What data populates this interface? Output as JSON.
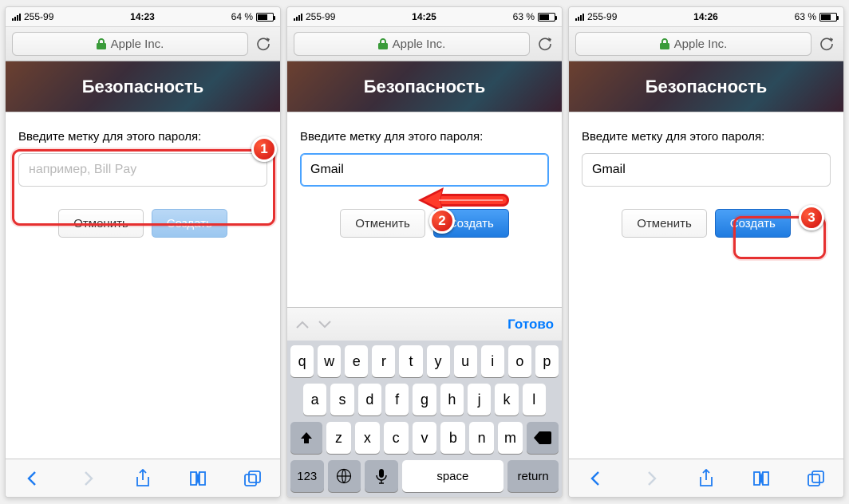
{
  "screens": [
    {
      "status": {
        "carrier": "255-99",
        "time": "14:23",
        "battery_percent": "64 %",
        "battery_fill": 0.64,
        "step": "1"
      },
      "address": "Apple Inc.",
      "banner_title": "Безопасность",
      "form": {
        "label": "Введите метку для этого пароля:",
        "value": "",
        "placeholder": "например, Bill Pay",
        "cancel": "Отменить",
        "create": "Создать",
        "create_disabled": true,
        "focused": false
      }
    },
    {
      "status": {
        "carrier": "255-99",
        "time": "14:25",
        "battery_percent": "63 %",
        "battery_fill": 0.63,
        "step": "2"
      },
      "address": "Apple Inc.",
      "banner_title": "Безопасность",
      "form": {
        "label": "Введите метку для этого пароля:",
        "value": "Gmail",
        "placeholder": "",
        "cancel": "Отменить",
        "create": "Создать",
        "create_disabled": false,
        "focused": true
      },
      "keyboard": {
        "done": "Готово",
        "rows": [
          [
            "q",
            "w",
            "e",
            "r",
            "t",
            "y",
            "u",
            "i",
            "o",
            "p"
          ],
          [
            "a",
            "s",
            "d",
            "f",
            "g",
            "h",
            "j",
            "k",
            "l"
          ],
          [
            "z",
            "x",
            "c",
            "v",
            "b",
            "n",
            "m"
          ]
        ],
        "key_123": "123",
        "key_space": "space",
        "key_return": "return"
      }
    },
    {
      "status": {
        "carrier": "255-99",
        "time": "14:26",
        "battery_percent": "63 %",
        "battery_fill": 0.63,
        "step": "3"
      },
      "address": "Apple Inc.",
      "banner_title": "Безопасность",
      "form": {
        "label": "Введите метку для этого пароля:",
        "value": "Gmail",
        "placeholder": "",
        "cancel": "Отменить",
        "create": "Создать",
        "create_disabled": false,
        "focused": false
      }
    }
  ]
}
